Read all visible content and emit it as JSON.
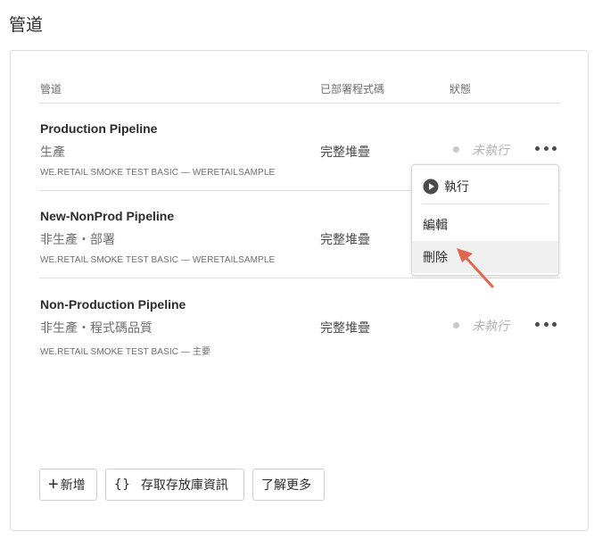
{
  "page": {
    "title": "管道"
  },
  "table": {
    "headers": {
      "pipeline": "管道",
      "deployed_code": "已部署程式碼",
      "status": "狀態"
    },
    "rows": [
      {
        "name": "Production Pipeline",
        "type": "生產",
        "repo": "WE.RETAIL SMOKE TEST BASIC — WERETAILSAMPLE",
        "deployed": "完整堆疊",
        "status": "未執行",
        "show_status": true
      },
      {
        "name": "New-NonProd Pipeline",
        "type": "非生產・部署",
        "repo": "WE.RETAIL SMOKE TEST BASIC — WERETAILSAMPLE",
        "deployed": "完整堆疊",
        "status": "",
        "show_status": false
      },
      {
        "name": "Non-Production Pipeline",
        "type": "非生產・程式碼品質",
        "repo": "WE.RETAIL SMOKE TEST BASIC — 主要",
        "deployed": "完整堆疊",
        "status": "未執行",
        "show_status": true
      }
    ]
  },
  "context_menu": {
    "items": [
      {
        "label": "執行",
        "icon": "play-circle-icon"
      },
      {
        "label": "編輯"
      },
      {
        "label": "刪除",
        "highlighted": true
      }
    ]
  },
  "footer": {
    "add_label": "新增",
    "repo_label": "存取存放庫資訊",
    "learn_label": "了解更多"
  },
  "colors": {
    "annotation_arrow": "#e06650",
    "menu_highlight": "#f0f0f0"
  }
}
